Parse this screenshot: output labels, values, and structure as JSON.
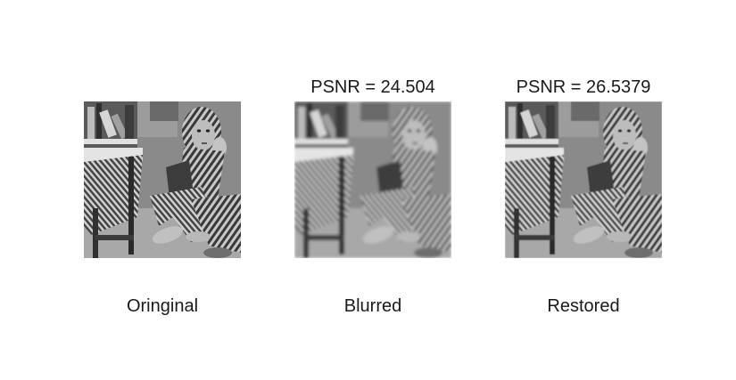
{
  "panels": [
    {
      "caption": "Oringinal",
      "psnr": ""
    },
    {
      "caption": "Blurred",
      "psnr": "PSNR = 24.504"
    },
    {
      "caption": "Restored",
      "psnr": "PSNR = 26.5379"
    }
  ]
}
